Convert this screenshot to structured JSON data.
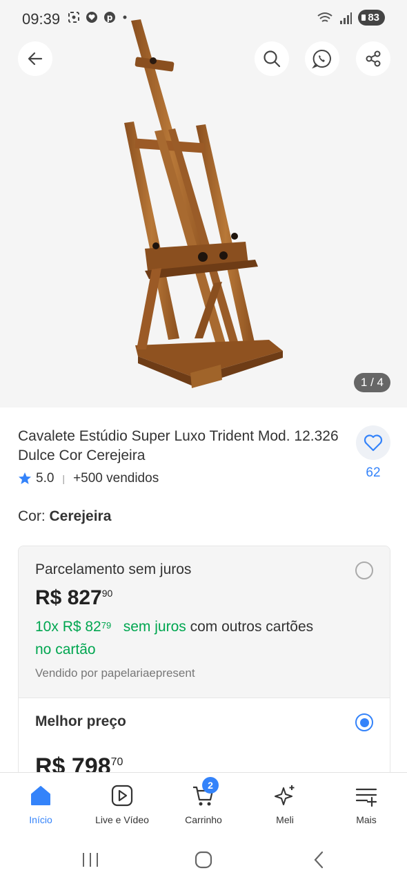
{
  "status_bar": {
    "time": "09:39",
    "battery": "83"
  },
  "gallery": {
    "pager": "1 / 4"
  },
  "product": {
    "title": "Cavalete Estúdio Super Luxo Trident Mod. 12.326 Dulce Cor Cerejeira",
    "rating": "5.0",
    "sold": "+500 vendidos",
    "favorites_count": "62",
    "color_label": "Cor: ",
    "color_value": "Cerejeira"
  },
  "payment_options": {
    "installment_option": {
      "title": "Parcelamento sem juros",
      "price_currency": "R$ ",
      "price_integer": "827",
      "price_cents": "90",
      "installments_prefix": "10x R$ 82",
      "installments_cents": "79",
      "installments_no_interest": "sem juros",
      "installments_other_cards": "com outros cartões",
      "installments_suffix": "no cartão",
      "seller": "Vendido por papelariaepresent",
      "selected": false
    },
    "best_price_option": {
      "title": "Melhor preço",
      "price_currency": "R$ ",
      "price_integer": "798",
      "price_cents": "70",
      "selected": true
    }
  },
  "bottom_nav": {
    "items": [
      {
        "label": "Início",
        "icon": "home-icon",
        "active": true
      },
      {
        "label": "Live e Vídeo",
        "icon": "play-icon",
        "active": false
      },
      {
        "label": "Carrinho",
        "icon": "cart-icon",
        "active": false,
        "badge": "2"
      },
      {
        "label": "Meli",
        "icon": "sparkle-icon",
        "active": false
      },
      {
        "label": "Mais",
        "icon": "menu-plus-icon",
        "active": false
      }
    ]
  },
  "colors": {
    "accent": "#3483fa",
    "green": "#00a650",
    "wood": "#a0642a"
  }
}
